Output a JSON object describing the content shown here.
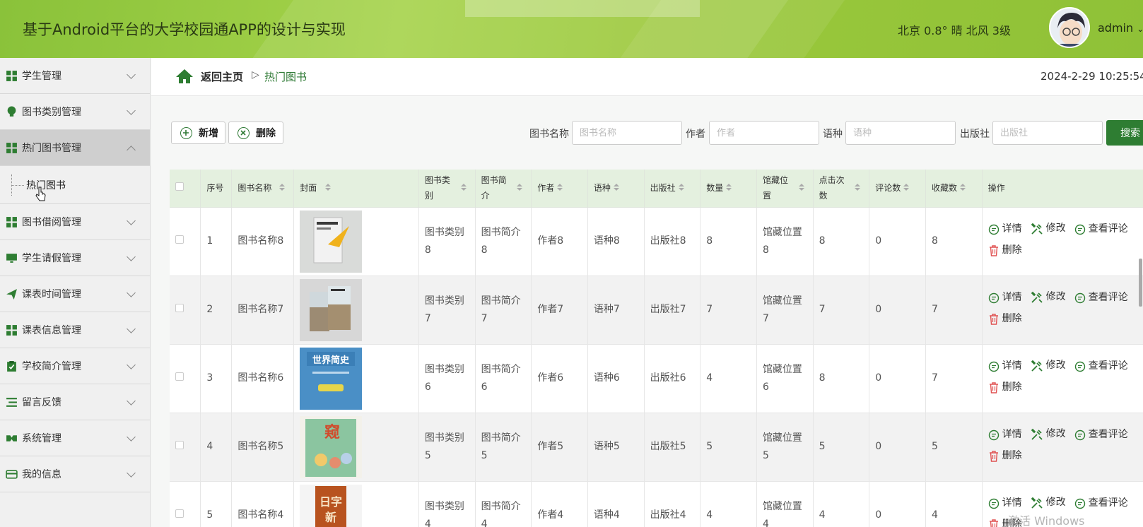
{
  "header": {
    "title": "基于Android平台的大学校园通APP的设计与实现",
    "weather": "北京  0.8°  晴  北风  3级",
    "username": "admin"
  },
  "sidebar": {
    "items": [
      {
        "label": "学生管理",
        "icon": "grid-icon"
      },
      {
        "label": "图书类别管理",
        "icon": "bulb-icon"
      },
      {
        "label": "热门图书管理",
        "icon": "grid-icon"
      },
      {
        "label": "图书借阅管理",
        "icon": "grid-icon"
      },
      {
        "label": "学生请假管理",
        "icon": "monitor-icon"
      },
      {
        "label": "课表时间管理",
        "icon": "send-icon"
      },
      {
        "label": "课表信息管理",
        "icon": "grid-icon"
      },
      {
        "label": "学校简介管理",
        "icon": "clipboard-icon"
      },
      {
        "label": "留言反馈",
        "icon": "list-icon"
      },
      {
        "label": "系统管理",
        "icon": "gamepad-icon"
      },
      {
        "label": "我的信息",
        "icon": "card-icon"
      }
    ],
    "sub_item": "热门图书"
  },
  "breadcrumb": {
    "home": "返回主页",
    "separator": "▷",
    "current": "热门图书"
  },
  "datetime": "2024-2-29 10:25:54",
  "toolbar": {
    "add_label": "新增",
    "delete_label": "删除",
    "search_label": "搜索",
    "filters": [
      {
        "label": "图书名称",
        "placeholder": "图书名称"
      },
      {
        "label": "作者",
        "placeholder": "作者"
      },
      {
        "label": "语种",
        "placeholder": "语种"
      },
      {
        "label": "出版社",
        "placeholder": "出版社"
      }
    ]
  },
  "table": {
    "columns": [
      "序号",
      "图书名称",
      "封面",
      "图书类别",
      "图书简介",
      "作者",
      "语种",
      "出版社",
      "数量",
      "馆藏位置",
      "点击次数",
      "评论数",
      "收藏数",
      "操作"
    ],
    "rows": [
      {
        "no": "1",
        "name": "图书名称8",
        "category": "图书类别8",
        "intro": "图书简介8",
        "author": "作者8",
        "lang": "语种8",
        "publisher": "出版社8",
        "qty": "8",
        "location": "馆藏位置8",
        "clicks": "8",
        "comments": "0",
        "favorites": "8"
      },
      {
        "no": "2",
        "name": "图书名称7",
        "category": "图书类别7",
        "intro": "图书简介7",
        "author": "作者7",
        "lang": "语种7",
        "publisher": "出版社7",
        "qty": "7",
        "location": "馆藏位置7",
        "clicks": "7",
        "comments": "0",
        "favorites": "7"
      },
      {
        "no": "3",
        "name": "图书名称6",
        "category": "图书类别6",
        "intro": "图书简介6",
        "author": "作者6",
        "lang": "语种6",
        "publisher": "出版社6",
        "qty": "4",
        "location": "馆藏位置6",
        "clicks": "8",
        "comments": "0",
        "favorites": "7"
      },
      {
        "no": "4",
        "name": "图书名称5",
        "category": "图书类别5",
        "intro": "图书简介5",
        "author": "作者5",
        "lang": "语种5",
        "publisher": "出版社5",
        "qty": "5",
        "location": "馆藏位置5",
        "clicks": "5",
        "comments": "0",
        "favorites": "5"
      },
      {
        "no": "5",
        "name": "图书名称4",
        "category": "图书类别4",
        "intro": "图书简介4",
        "author": "作者4",
        "lang": "语种4",
        "publisher": "出版社4",
        "qty": "4",
        "location": "馆藏位置4",
        "clicks": "4",
        "comments": "0",
        "favorites": "4"
      }
    ],
    "actions": {
      "detail": "详情",
      "edit": "修改",
      "comments": "查看评论",
      "delete": "删除"
    }
  },
  "watermark": "激活 Windows",
  "colors": {
    "accent": "#2e7d32",
    "header_green": "#9cc93c",
    "table_header": "#e4f0df"
  }
}
